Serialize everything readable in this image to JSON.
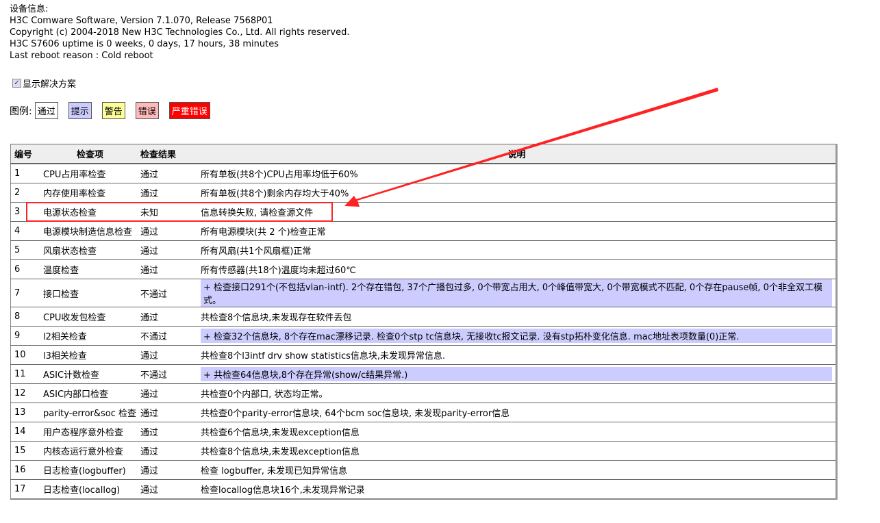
{
  "device_info": {
    "heading": "设备信息:",
    "lines": [
      "H3C Comware Software, Version 7.1.070, Release 7568P01",
      "Copyright (c) 2004-2018 New H3C Technologies Co., Ltd. All rights reserved.",
      "H3C S7606 uptime is 0 weeks, 0 days, 17 hours, 38 minutes",
      "Last reboot reason : Cold reboot"
    ]
  },
  "show_solution": {
    "label": "显示解决方案",
    "checked": true
  },
  "legend": {
    "label": "图例:",
    "items": [
      {
        "label": "通过",
        "bg": "#ffffff",
        "fg": "#000000"
      },
      {
        "label": "提示",
        "bg": "#ccccff",
        "fg": "#000000"
      },
      {
        "label": "警告",
        "bg": "#ffff99",
        "fg": "#000000"
      },
      {
        "label": "错误",
        "bg": "#ffbbbb",
        "fg": "#000000"
      },
      {
        "label": "严重错误",
        "bg": "#ff0000",
        "fg": "#ffffff"
      }
    ]
  },
  "table": {
    "headers": [
      "编号",
      "检查项",
      "检查结果",
      "说明"
    ],
    "rows": [
      {
        "id": "1",
        "item": "CPU占用率检查",
        "result": "通过",
        "desc": "所有单板(共8个)CPU占用率均低于60%",
        "hint": false
      },
      {
        "id": "2",
        "item": "内存使用率检查",
        "result": "通过",
        "desc": "所有单板(共8个)剩余内存均大于40%",
        "hint": false
      },
      {
        "id": "3",
        "item": "电源状态检查",
        "result": "未知",
        "desc": "信息转换失败, 请检查源文件",
        "hint": false
      },
      {
        "id": "4",
        "item": "电源模块制造信息检查",
        "result": "通过",
        "desc": "所有电源模块(共 2 个)检查正常",
        "hint": false
      },
      {
        "id": "5",
        "item": "风扇状态检查",
        "result": "通过",
        "desc": "所有风扇(共1个风扇框)正常",
        "hint": false
      },
      {
        "id": "6",
        "item": "温度检查",
        "result": "通过",
        "desc": "所有传感器(共18个)温度均未超过60℃",
        "hint": false
      },
      {
        "id": "7",
        "item": "接口检查",
        "result": "不通过",
        "desc": "+ 检查接口291个(不包括vlan-intf). 2个存在错包, 37个广播包过多, 0个带宽占用大, 0个峰值带宽大, 0个带宽模式不匹配, 0个存在pause帧, 0个非全双工模式。",
        "hint": true
      },
      {
        "id": "8",
        "item": "CPU收发包检查",
        "result": "通过",
        "desc": "共检查8个信息块,未发现存在软件丢包",
        "hint": false
      },
      {
        "id": "9",
        "item": "l2相关检查",
        "result": "不通过",
        "desc": "+ 检查32个信息块, 8个存在mac漂移记录. 检查0个stp tc信息块, 无接收tc报文记录. 没有stp拓朴变化信息. mac地址表项数量(0)正常.",
        "hint": true
      },
      {
        "id": "10",
        "item": "l3相关检查",
        "result": "通过",
        "desc": "共检查8个l3intf drv show statistics信息块,未发现异常信息.",
        "hint": false
      },
      {
        "id": "11",
        "item": "ASIC计数检查",
        "result": "不通过",
        "desc": "+ 共检查64信息块,8个存在异常(show/c结果异常.)",
        "hint": true
      },
      {
        "id": "12",
        "item": "ASIC内部口检查",
        "result": "通过",
        "desc": "共检查0个内部口, 状态均正常。",
        "hint": false
      },
      {
        "id": "13",
        "item": "parity-error&soc 检查",
        "result": "通过",
        "desc": "共检查0个parity-error信息块, 64个bcm soc信息块, 未发现parity-error信息",
        "hint": false
      },
      {
        "id": "14",
        "item": "用户态程序意外检查",
        "result": "通过",
        "desc": "共检查6个信息块,未发现exception信息",
        "hint": false
      },
      {
        "id": "15",
        "item": "内核态运行意外检查",
        "result": "通过",
        "desc": "共检查8个信息块,未发现exception信息",
        "hint": false
      },
      {
        "id": "16",
        "item": "日志检查(logbuffer)",
        "result": "通过",
        "desc": "检查 logbuffer, 未发现已知异常信息",
        "hint": false
      },
      {
        "id": "17",
        "item": "日志检查(locallog)",
        "result": "通过",
        "desc": "检查locallog信息块16个,未发现异常记录",
        "hint": false
      }
    ]
  },
  "annotation": {
    "color": "#ff2222",
    "highlighted_row": "3"
  }
}
